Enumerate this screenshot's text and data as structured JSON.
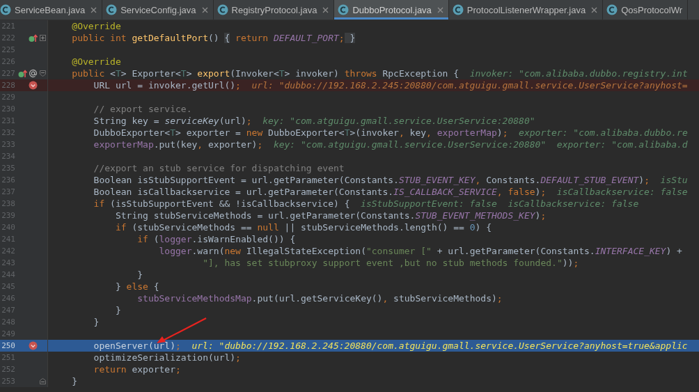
{
  "tabs": [
    {
      "label": "ServiceBean.java",
      "selected": false,
      "close_button": true
    },
    {
      "label": "ServiceConfig.java",
      "selected": false,
      "close_button": true
    },
    {
      "label": "RegistryProtocol.java",
      "selected": false,
      "close_button": true
    },
    {
      "label": "DubboProtocol.java",
      "selected": true,
      "close_button": true
    },
    {
      "label": "ProtocolListenerWrapper.java",
      "selected": false,
      "close_button": true
    },
    {
      "label": "QosProtocolWr",
      "selected": false,
      "close_button": false
    }
  ],
  "lines": [
    {
      "number": "221",
      "breakpoint": false,
      "current": false,
      "code": [
        {
          "kind": "annotation",
          "text": "    @Override"
        }
      ]
    },
    {
      "number": "222",
      "breakpoint": false,
      "current": false,
      "gutter_icons": [
        {
          "kind": "overrides"
        }
      ],
      "fold": {
        "kind": "expand"
      },
      "code": [
        {
          "kind": "keyword",
          "text": "    public int "
        },
        {
          "kind": "method",
          "text": "getDefaultPort"
        },
        {
          "kind": "plain",
          "text": "() "
        },
        {
          "kind": "folded",
          "text": "{"
        },
        {
          "kind": "keyword",
          "text": " return "
        },
        {
          "kind": "constant",
          "text": "DEFAULT_PORT"
        },
        {
          "kind": "keyword",
          "text": ";"
        },
        {
          "kind": "folded",
          "text": " }"
        }
      ]
    },
    {
      "number": "225",
      "breakpoint": false,
      "current": false
    },
    {
      "number": "226",
      "breakpoint": false,
      "current": false,
      "code": [
        {
          "kind": "annotation",
          "text": "    @Override"
        }
      ]
    },
    {
      "number": "227",
      "breakpoint": false,
      "current": false,
      "gutter_icons": [
        {
          "kind": "overrides"
        },
        {
          "kind": "annotated"
        }
      ],
      "fold": {
        "kind": "collapse"
      },
      "code": [
        {
          "kind": "keyword",
          "text": "    public "
        },
        {
          "kind": "plain",
          "text": "<"
        },
        {
          "kind": "generic",
          "text": "T"
        },
        {
          "kind": "plain",
          "text": "> Exporter<"
        },
        {
          "kind": "generic",
          "text": "T"
        },
        {
          "kind": "plain",
          "text": "> "
        },
        {
          "kind": "method",
          "text": "export"
        },
        {
          "kind": "plain",
          "text": "(Invoker<"
        },
        {
          "kind": "generic",
          "text": "T"
        },
        {
          "kind": "plain",
          "text": "> invoker) "
        },
        {
          "kind": "keyword",
          "text": "throws "
        },
        {
          "kind": "plain",
          "text": "RpcException {"
        }
      ],
      "hint": "invoker: \"com.alibaba.dubbo.registry.int"
    },
    {
      "number": "228",
      "breakpoint": true,
      "current": false,
      "code": [
        {
          "kind": "plain",
          "text": "        URL url = invoker.getUrl()"
        },
        {
          "kind": "keyword",
          "text": ";"
        }
      ],
      "hint": "url: \"dubbo://192.168.2.245:20880/com.atguigu.gmall.service.UserService?anyhost="
    },
    {
      "number": "229",
      "breakpoint": false,
      "current": false
    },
    {
      "number": "230",
      "breakpoint": false,
      "current": false,
      "code": [
        {
          "kind": "comment",
          "text": "        // export service."
        }
      ]
    },
    {
      "number": "231",
      "breakpoint": false,
      "current": false,
      "code": [
        {
          "kind": "plain",
          "text": "        String key = "
        },
        {
          "kind": "static",
          "text": "serviceKey"
        },
        {
          "kind": "plain",
          "text": "(url)"
        },
        {
          "kind": "keyword",
          "text": ";"
        }
      ],
      "hint": "key: \"com.atguigu.gmall.service.UserService:20880\""
    },
    {
      "number": "232",
      "breakpoint": false,
      "current": false,
      "code": [
        {
          "kind": "plain",
          "text": "        DubboExporter<"
        },
        {
          "kind": "generic",
          "text": "T"
        },
        {
          "kind": "plain",
          "text": "> exporter = "
        },
        {
          "kind": "keyword",
          "text": "new "
        },
        {
          "kind": "plain",
          "text": "DubboExporter<"
        },
        {
          "kind": "generic",
          "text": "T"
        },
        {
          "kind": "plain",
          "text": ">(invoker"
        },
        {
          "kind": "keyword",
          "text": ", "
        },
        {
          "kind": "plain",
          "text": "key"
        },
        {
          "kind": "keyword",
          "text": ", "
        },
        {
          "kind": "field",
          "text": "exporterMap"
        },
        {
          "kind": "plain",
          "text": ")"
        },
        {
          "kind": "keyword",
          "text": ";"
        }
      ],
      "hint": "exporter: \"com.alibaba.dubbo.re"
    },
    {
      "number": "233",
      "breakpoint": false,
      "current": false,
      "code": [
        {
          "kind": "field",
          "text": "        exporterMap"
        },
        {
          "kind": "plain",
          "text": ".put(key"
        },
        {
          "kind": "keyword",
          "text": ", "
        },
        {
          "kind": "plain",
          "text": "exporter)"
        },
        {
          "kind": "keyword",
          "text": ";"
        }
      ],
      "hint": "key: \"com.atguigu.gmall.service.UserService:20880\"  exporter: \"com.alibaba.d"
    },
    {
      "number": "234",
      "breakpoint": false,
      "current": false
    },
    {
      "number": "235",
      "breakpoint": false,
      "current": false,
      "code": [
        {
          "kind": "comment",
          "text": "        //export an stub service for dispatching event"
        }
      ]
    },
    {
      "number": "236",
      "breakpoint": false,
      "current": false,
      "code": [
        {
          "kind": "plain",
          "text": "        Boolean isStubSupportEvent = url.getParameter(Constants."
        },
        {
          "kind": "constant",
          "text": "STUB_EVENT_KEY"
        },
        {
          "kind": "keyword",
          "text": ", "
        },
        {
          "kind": "plain",
          "text": "Constants."
        },
        {
          "kind": "constant",
          "text": "DEFAULT_STUB_EVENT"
        },
        {
          "kind": "plain",
          "text": ")"
        },
        {
          "kind": "keyword",
          "text": ";"
        }
      ],
      "hint": "isStu"
    },
    {
      "number": "237",
      "breakpoint": false,
      "current": false,
      "code": [
        {
          "kind": "plain",
          "text": "        Boolean isCallbackservice = url.getParameter(Constants."
        },
        {
          "kind": "constant",
          "text": "IS_CALLBACK_SERVICE"
        },
        {
          "kind": "keyword",
          "text": ", false"
        },
        {
          "kind": "plain",
          "text": ")"
        },
        {
          "kind": "keyword",
          "text": ";"
        }
      ],
      "hint": "isCallbackservice: false"
    },
    {
      "number": "238",
      "breakpoint": false,
      "current": false,
      "code": [
        {
          "kind": "keyword",
          "text": "        if "
        },
        {
          "kind": "plain",
          "text": "(isStubSupportEvent && !isCallbackservice) {"
        }
      ],
      "hint": "isStubSupportEvent: false  isCallbackservice: false"
    },
    {
      "number": "239",
      "breakpoint": false,
      "current": false,
      "code": [
        {
          "kind": "plain",
          "text": "            String stubServiceMethods = url.getParameter(Constants."
        },
        {
          "kind": "constant",
          "text": "STUB_EVENT_METHODS_KEY"
        },
        {
          "kind": "plain",
          "text": ")"
        },
        {
          "kind": "keyword",
          "text": ";"
        }
      ]
    },
    {
      "number": "240",
      "breakpoint": false,
      "current": false,
      "code": [
        {
          "kind": "keyword",
          "text": "            if "
        },
        {
          "kind": "plain",
          "text": "(stubServiceMethods == "
        },
        {
          "kind": "keyword",
          "text": "null "
        },
        {
          "kind": "plain",
          "text": "|| stubServiceMethods.length() == "
        },
        {
          "kind": "number",
          "text": "0"
        },
        {
          "kind": "plain",
          "text": ") {"
        }
      ]
    },
    {
      "number": "241",
      "breakpoint": false,
      "current": false,
      "code": [
        {
          "kind": "keyword",
          "text": "                if "
        },
        {
          "kind": "plain",
          "text": "("
        },
        {
          "kind": "field",
          "text": "logger"
        },
        {
          "kind": "plain",
          "text": ".isWarnEnabled()) {"
        }
      ]
    },
    {
      "number": "242",
      "breakpoint": false,
      "current": false,
      "code": [
        {
          "kind": "field",
          "text": "                    logger"
        },
        {
          "kind": "plain",
          "text": ".warn("
        },
        {
          "kind": "keyword",
          "text": "new "
        },
        {
          "kind": "plain",
          "text": "IllegalStateException("
        },
        {
          "kind": "string",
          "text": "\"consumer [\""
        },
        {
          "kind": "plain",
          "text": " + url.getParameter(Constants."
        },
        {
          "kind": "constant",
          "text": "INTERFACE_KEY"
        },
        {
          "kind": "plain",
          "text": ") +"
        }
      ]
    },
    {
      "number": "243",
      "breakpoint": false,
      "current": false,
      "code": [
        {
          "kind": "string",
          "text": "                            \"], has set stubproxy support event ,but no stub methods founded.\""
        },
        {
          "kind": "plain",
          "text": "))"
        },
        {
          "kind": "keyword",
          "text": ";"
        }
      ]
    },
    {
      "number": "244",
      "breakpoint": false,
      "current": false,
      "code": [
        {
          "kind": "plain",
          "text": "                }"
        }
      ]
    },
    {
      "number": "245",
      "breakpoint": false,
      "current": false,
      "code": [
        {
          "kind": "plain",
          "text": "            } "
        },
        {
          "kind": "keyword",
          "text": "else "
        },
        {
          "kind": "plain",
          "text": "{"
        }
      ]
    },
    {
      "number": "246",
      "breakpoint": false,
      "current": false,
      "code": [
        {
          "kind": "field",
          "text": "                stubServiceMethodsMap"
        },
        {
          "kind": "plain",
          "text": ".put(url.getServiceKey()"
        },
        {
          "kind": "keyword",
          "text": ", "
        },
        {
          "kind": "plain",
          "text": "stubServiceMethods)"
        },
        {
          "kind": "keyword",
          "text": ";"
        }
      ]
    },
    {
      "number": "247",
      "breakpoint": false,
      "current": false,
      "code": [
        {
          "kind": "plain",
          "text": "            }"
        }
      ]
    },
    {
      "number": "248",
      "breakpoint": false,
      "current": false,
      "code": [
        {
          "kind": "plain",
          "text": "        }"
        }
      ]
    },
    {
      "number": "249",
      "breakpoint": false,
      "current": false
    },
    {
      "number": "250",
      "breakpoint": true,
      "current": true,
      "code": [
        {
          "kind": "plain",
          "text": "        openServer(url)"
        },
        {
          "kind": "keyword",
          "text": ";"
        }
      ],
      "hint": "url: \"dubbo://192.168.2.245:20880/com.atguigu.gmall.service.UserService?anyhost=true&applic"
    },
    {
      "number": "251",
      "breakpoint": false,
      "current": false,
      "code": [
        {
          "kind": "plain",
          "text": "        optimizeSerialization(url)"
        },
        {
          "kind": "keyword",
          "text": ";"
        }
      ]
    },
    {
      "number": "252",
      "breakpoint": false,
      "current": false,
      "code": [
        {
          "kind": "keyword",
          "text": "        return "
        },
        {
          "kind": "plain",
          "text": "exporter"
        },
        {
          "kind": "keyword",
          "text": ";"
        }
      ]
    },
    {
      "number": "253",
      "breakpoint": false,
      "current": false,
      "fold": {
        "kind": "end"
      },
      "code": [
        {
          "kind": "plain",
          "text": "    }"
        }
      ]
    }
  ]
}
